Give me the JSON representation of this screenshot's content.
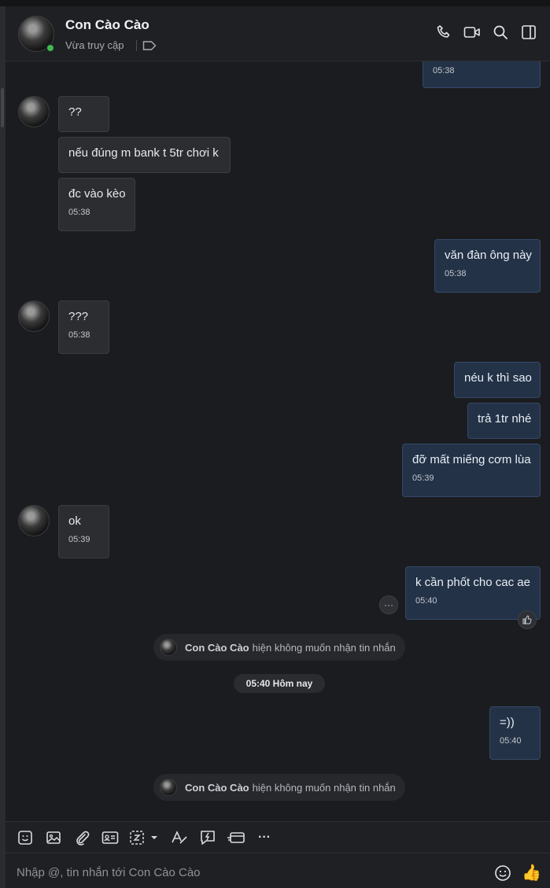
{
  "contact": {
    "name": "Con Cào Cào",
    "status": "Vừa truy cập"
  },
  "header_icons": [
    "phone-icon",
    "video-call-icon",
    "search-icon",
    "sidebar-toggle-icon"
  ],
  "messages": {
    "m0_time": "05:38",
    "m1_text": "??",
    "m2_text": "nếu đúng m bank t 5tr chơi k",
    "m3_text": "đc vào kèo",
    "m3_time": "05:38",
    "m4_text": "văn đàn ông này",
    "m4_time": "05:38",
    "m5_text": "???",
    "m5_time": "05:38",
    "m6_text": "néu k thì sao",
    "m7_text": "trả 1tr nhé",
    "m8_text": "đỡ mất miếng cơm lùa",
    "m8_time": "05:39",
    "m9_text": "ok",
    "m9_time": "05:39",
    "m10_text": "k cần phốt cho cac ae",
    "m10_time": "05:40",
    "m11_text": "=))",
    "m11_time": "05:40"
  },
  "system_notice": {
    "name": "Con Cào Cào",
    "text": "hiện không muốn nhận tin nhắn"
  },
  "date_divider": "05:40 Hôm nay",
  "more_button": "···",
  "toolbar_icons": [
    "sticker-icon",
    "image-icon",
    "attachment-icon",
    "contact-card-icon",
    "screenshot-icon",
    "text-format-icon",
    "quick-message-icon",
    "card-icon",
    "more-icon"
  ],
  "more_label": "···",
  "composer": {
    "placeholder": "Nhập @, tin nhắn tới Con Cào Cào",
    "like": "👍"
  },
  "colors": {
    "background": "#1b1c1f",
    "incoming": "#2b2d31",
    "outgoing": "#233246",
    "online": "#3fb950"
  }
}
